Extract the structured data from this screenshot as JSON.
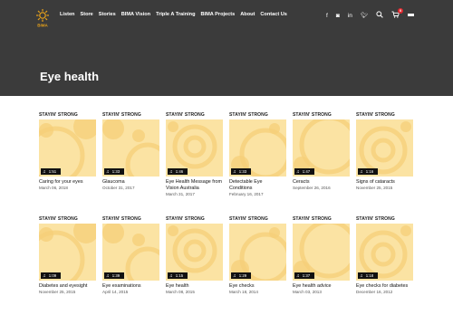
{
  "header": {
    "logo_text": "BIMA",
    "nav": [
      "Listen",
      "Store",
      "Stories",
      "BIMA Vision",
      "Triple A Training",
      "BIMA Projects",
      "About",
      "Contact Us"
    ],
    "icons": [
      "facebook-icon",
      "instagram-icon",
      "linkedin-icon",
      "twitter-icon",
      "search-icon",
      "cart-icon",
      "menu-icon"
    ],
    "cart_count": "0"
  },
  "page": {
    "title": "Eye health"
  },
  "episodes": [
    {
      "brand": "STAYIN' STRONG",
      "duration": "1:51",
      "title": "Caring for your eyes",
      "date": "March 06, 2018"
    },
    {
      "brand": "STAYIN' STRONG",
      "duration": "1:33",
      "title": "Glaucoma",
      "date": "October 31, 2017"
    },
    {
      "brand": "STAYIN' STRONG",
      "duration": "1:46",
      "title": "Eye Health Message from Vision Australia",
      "date": "March 31, 2017"
    },
    {
      "brand": "STAYIN' STRONG",
      "duration": "1:33",
      "title": "Detectable Eye Conditions",
      "date": "February 16, 2017"
    },
    {
      "brand": "STAYIN' STRONG",
      "duration": "1:47",
      "title": "Ceracts",
      "date": "September 26, 2016"
    },
    {
      "brand": "STAYIN' STRONG",
      "duration": "1:16",
      "title": "Signs of cataracts",
      "date": "November 25, 2015"
    },
    {
      "brand": "STAYIN' STRONG",
      "duration": "1:09",
      "title": "Diabetes and eyesight",
      "date": "November 25, 2015"
    },
    {
      "brand": "STAYIN' STRONG",
      "duration": "1:39",
      "title": "Eye examinations",
      "date": "April 14, 2015"
    },
    {
      "brand": "STAYIN' STRONG",
      "duration": "1:15",
      "title": "Eye health",
      "date": "March 08, 2015"
    },
    {
      "brand": "STAYIN' STRONG",
      "duration": "1:29",
      "title": "Eye checks",
      "date": "March 18, 2014"
    },
    {
      "brand": "STAYIN' STRONG",
      "duration": "1:37",
      "title": "Eye health advice",
      "date": "March 03, 2013"
    },
    {
      "brand": "STAYIN' STRONG",
      "duration": "1:18",
      "title": "Eye checks for diabetes",
      "date": "December 16, 2012"
    }
  ],
  "colors": {
    "hero_bg": "#3b3b3b",
    "thumb_bg": "#fbe3a3",
    "thumb_circle": "#f6cf78",
    "badge": "#e0282e"
  }
}
